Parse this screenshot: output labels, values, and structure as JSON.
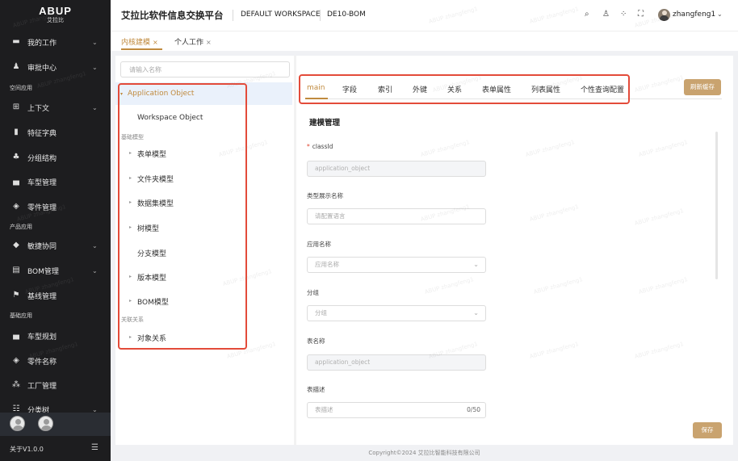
{
  "sidebar": {
    "logo_text": "ABUP",
    "logo_sub": "艾拉比",
    "items": [
      {
        "label": "我的工作",
        "chevron": "⌄"
      },
      {
        "label": "审批中心",
        "chevron": "⌄"
      },
      {
        "label": "上下文",
        "chevron": "⌄"
      },
      {
        "label": "特征字典"
      },
      {
        "label": "分组结构"
      },
      {
        "label": "车型管理"
      },
      {
        "label": "零件管理"
      },
      {
        "label": "敏捷协同",
        "chevron": "⌄"
      },
      {
        "label": "BOM管理",
        "chevron": "⌄"
      },
      {
        "label": "基线管理"
      },
      {
        "label": "车型规划"
      },
      {
        "label": "零件名称"
      },
      {
        "label": "工厂管理"
      },
      {
        "label": "分类树",
        "chevron": "⌄"
      }
    ],
    "sections": [
      "空间应用",
      "产品应用",
      "基础应用"
    ],
    "version": "关于V1.0.0"
  },
  "header": {
    "title": "艾拉比软件信息交换平台",
    "workspace": "DEFAULT WORKSPACE",
    "context": "DE10-BOM",
    "username": "zhangfeng1"
  },
  "page_tabs": [
    {
      "label": "内核建模",
      "close": "×"
    },
    {
      "label": "个人工作",
      "close": "×"
    }
  ],
  "tree": {
    "search_placeholder": "请输入名称",
    "selected": "Application Object",
    "workspace_object": "Workspace Object",
    "section1": "基础模型",
    "items1": [
      "表单模型",
      "文件夹模型",
      "数据集模型",
      "树模型",
      "分支模型",
      "版本模型",
      "BOM模型"
    ],
    "section2": "关联关系",
    "items2": [
      "对象关系"
    ]
  },
  "detail": {
    "tabs": [
      "main",
      "字段",
      "索引",
      "外键",
      "关系",
      "表单属性",
      "列表属性",
      "个性查询配置"
    ],
    "refresh_label": "刷新缓存",
    "section_title": "建模管理",
    "fields": [
      {
        "label": "classId",
        "required": "*",
        "value": "application_object"
      },
      {
        "label": "类型展示名称",
        "placeholder": "请配置语言"
      },
      {
        "label": "应用名称",
        "placeholder": "应用名称"
      },
      {
        "label": "分组",
        "placeholder": "分组"
      },
      {
        "label": "表名称",
        "value": "application_object"
      },
      {
        "label": "表描述",
        "placeholder": "表描述",
        "counter": "0/50"
      }
    ],
    "save_label": "保存"
  },
  "footer": "Copyright©2024 艾拉比智能科技有限公司",
  "watermark": "ABUP zhangfeng1",
  "colors": {
    "accent": "#c08a3e",
    "button": "#c9a36f",
    "highlight": "#e34b3a",
    "sidebar": "#1d1d1f"
  }
}
